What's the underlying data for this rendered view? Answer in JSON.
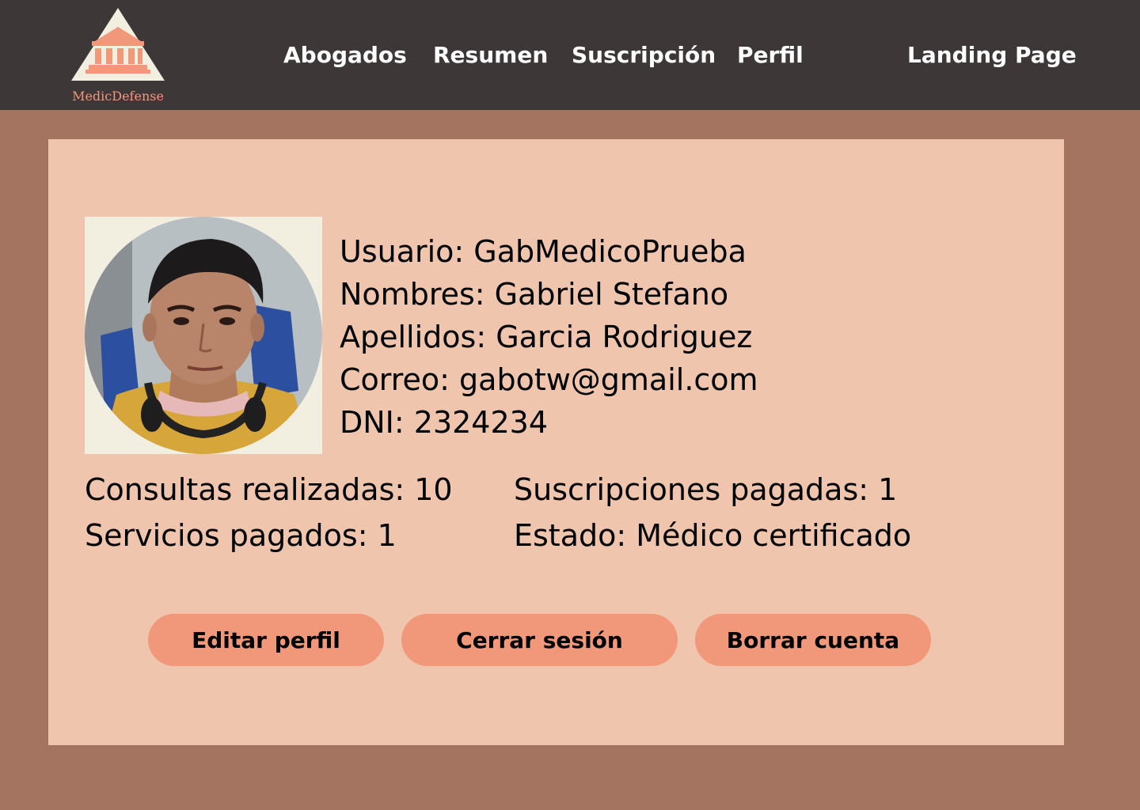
{
  "brand": {
    "name": "MedicDefense",
    "logo_icon": "courthouse-icon"
  },
  "nav": {
    "abogados": "Abogados",
    "resumen": "Resumen",
    "suscripcion": "Suscripción",
    "perfil": "Perfil",
    "landing": "Landing Page"
  },
  "profile": {
    "avatar": "profile-photo",
    "usuario": "Usuario: GabMedicoPrueba",
    "nombres": "Nombres: Gabriel Stefano",
    "apellidos": "Apellidos: Garcia Rodriguez",
    "correo": "Correo: gabotw@gmail.com",
    "dni": "DNI: 2324234"
  },
  "stats": {
    "consultas": "Consultas realizadas: 10",
    "servicios": "Servicios pagados: 1",
    "suscripciones": "Suscripciones pagadas: 1",
    "estado": "Estado: Médico certificado"
  },
  "actions": {
    "editar": "Editar perfil",
    "cerrar": "Cerrar sesión",
    "borrar": "Borrar cuenta"
  },
  "colors": {
    "navbar": "#3d3737",
    "page_background": "#a57461",
    "panel": "#f0c5ad",
    "accent": "#f1987a",
    "logo_background": "#f3efe0"
  }
}
